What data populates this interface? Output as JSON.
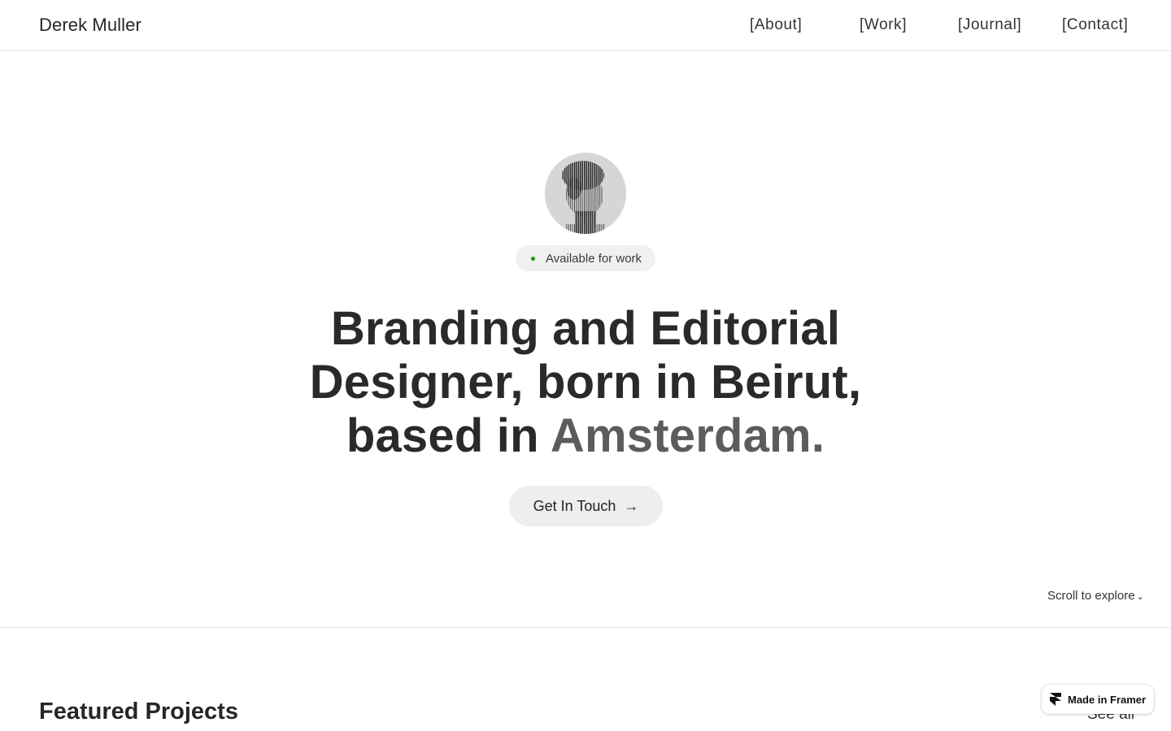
{
  "header": {
    "brand": "Derek Muller",
    "nav": [
      {
        "label": "[About]"
      },
      {
        "label": "[Work]"
      },
      {
        "label": "[Journal]"
      },
      {
        "label": "[Contact]"
      }
    ]
  },
  "hero": {
    "avatar_icon": "halftone-portrait",
    "status": {
      "label": "Available for work",
      "dot_color": "#2e8b22"
    },
    "title_line1": "Branding and Editorial",
    "title_line2": "Designer, born in Beirut,",
    "title_line3_prefix": "based in ",
    "title_line3_accent": "Amsterdam.",
    "cta": {
      "label": "Get In Touch",
      "icon": "arrow-right-icon"
    }
  },
  "scroll_hint": {
    "label": "Scroll to explore",
    "icon": "chevron-down-icon"
  },
  "featured": {
    "title": "Featured Projects",
    "see_all": "See all"
  },
  "framer_badge": {
    "label": "Made in Framer",
    "icon": "framer-logo-icon"
  },
  "colors": {
    "text": "#262626",
    "accent_text": "#5c5c5c",
    "pill_bg": "#f0f0f0",
    "cta_bg": "#eeeeee",
    "divider": "#e3e3e3"
  }
}
